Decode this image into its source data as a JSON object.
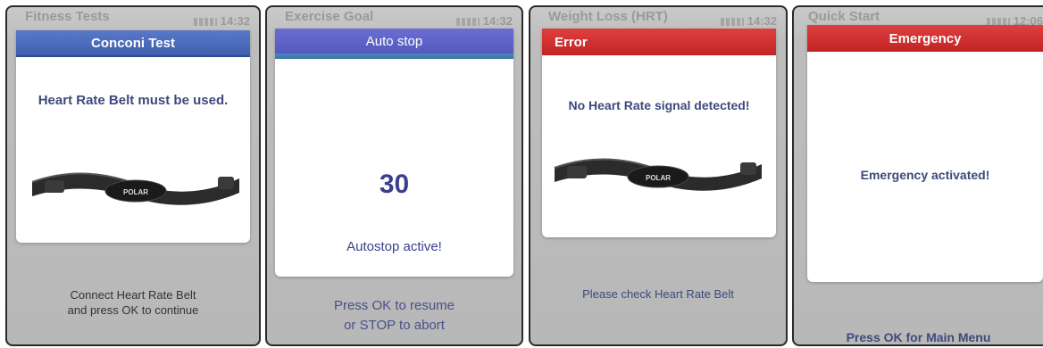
{
  "screens": [
    {
      "background_title": "Fitness Tests",
      "clock": "14:32",
      "dialog_title": "Conconi Test",
      "message": "Heart Rate Belt must be used.",
      "footer_line1": "Connect Heart Rate Belt",
      "footer_line2": "and press OK to continue",
      "belt_logo": "POLAR"
    },
    {
      "background_title": "Exercise Goal",
      "clock": "14:32",
      "dialog_title": "Auto stop",
      "countdown": "30",
      "message": "Autostop active!",
      "footer_line1": "Press OK to resume",
      "footer_line2": "or STOP to abort"
    },
    {
      "background_title": "Weight Loss (HRT)",
      "clock": "14:32",
      "dialog_title": "Error",
      "message": "No Heart Rate signal detected!",
      "footer_line1": "Please check Heart Rate Belt",
      "belt_logo": "POLAR"
    },
    {
      "background_title": "Quick Start",
      "clock": "12:06",
      "dialog_title": "Emergency",
      "message": "Emergency activated!",
      "footer_line1": "Press OK for Main Menu"
    }
  ],
  "colors": {
    "blue_header": "#4a6abb",
    "purple_header": "#5f63c7",
    "red_header": "#d03030",
    "message_text": "#3d4a7a"
  }
}
